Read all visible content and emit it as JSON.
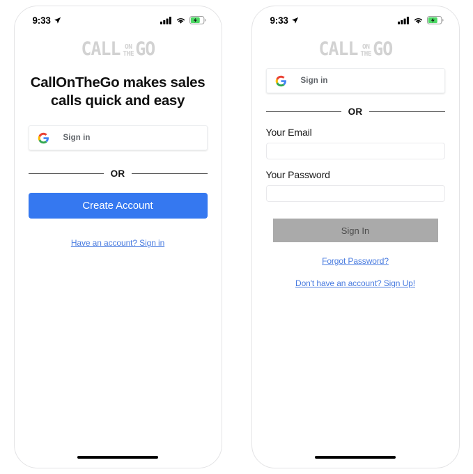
{
  "app": {
    "logo": {
      "main_left": "CALL",
      "stack_top": "ON",
      "stack_bottom": "THE",
      "main_right": "GO",
      "color": "#d2d2d2"
    }
  },
  "colors": {
    "primary_blue": "#3578f0",
    "link_blue": "#4a7ce0",
    "disabled_gray": "#aaaaaa",
    "battery_green": "#4cd964"
  },
  "status_bar": {
    "time": "9:33",
    "location_icon": "location-arrow-icon",
    "signal_icon": "cellular-signal-icon",
    "wifi_icon": "wifi-icon",
    "battery_icon": "battery-charging-icon"
  },
  "screen_signup": {
    "headline": "CallOnTheGo makes sales calls quick and easy",
    "google_button": {
      "label": "Sign in",
      "icon": "google-g-icon"
    },
    "divider_text": "OR",
    "create_account_label": "Create Account",
    "have_account_link": "Have an account? Sign in"
  },
  "screen_signin": {
    "google_button": {
      "label": "Sign in",
      "icon": "google-g-icon"
    },
    "divider_text": "OR",
    "email_label": "Your Email",
    "email_value": "",
    "email_placeholder": "",
    "password_label": "Your Password",
    "password_value": "",
    "password_placeholder": "",
    "sign_in_label": "Sign In",
    "forgot_password_link": "Forgot Password?",
    "sign_up_link": "Don't have an account? Sign Up!"
  }
}
